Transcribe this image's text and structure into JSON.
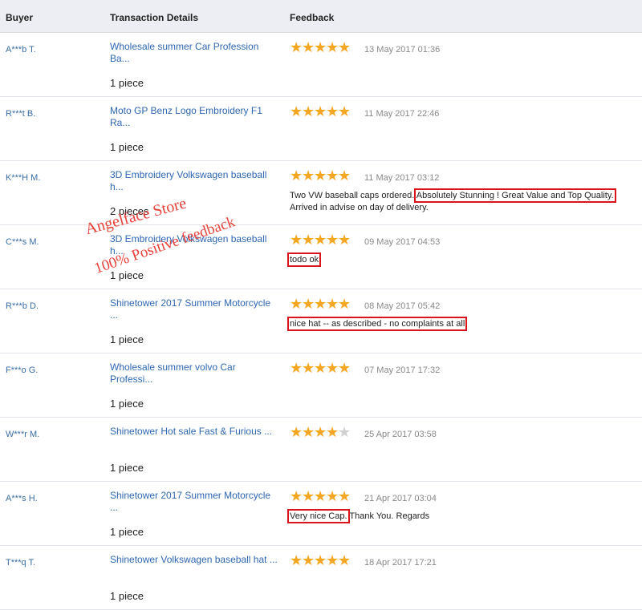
{
  "header": {
    "buyer": "Buyer",
    "transaction": "Transaction Details",
    "feedback": "Feedback"
  },
  "rows": [
    {
      "buyer": "A***b T.",
      "product": "Wholesale summer Car Profession Ba...",
      "qty": "1 piece",
      "stars": 5,
      "date": "13 May 2017 01:36",
      "comment": []
    },
    {
      "buyer": "R***t B.",
      "product": "Moto GP Benz Logo Embroidery F1 Ra...",
      "qty": "1 piece",
      "stars": 5,
      "date": "11 May 2017 22:46",
      "comment": []
    },
    {
      "buyer": "K***H M.",
      "product": "3D Embroidery Volkswagen baseball h...",
      "qty": "2 pieces",
      "stars": 5,
      "date": "11 May 2017 03:12",
      "comment": [
        {
          "text": "Two VW baseball caps ordered. ",
          "hl": false
        },
        {
          "text": "Absolutely Stunning ! Great Value and Top Quality.",
          "hl": true
        },
        {
          "text": " Arrived in advise on day of delivery.",
          "hl": false
        }
      ]
    },
    {
      "buyer": "C***s M.",
      "product": "3D Embroidery Volkswagen baseball h...",
      "qty": "1 piece",
      "stars": 5,
      "date": "09 May 2017 04:53",
      "comment": [
        {
          "text": "todo ok",
          "hl": true
        }
      ]
    },
    {
      "buyer": "R***b D.",
      "product": "Shinetower 2017 Summer Motorcycle ...",
      "qty": "1 piece",
      "stars": 5,
      "date": "08 May 2017 05:42",
      "comment": [
        {
          "text": "nice hat -- as described - no complaints at all",
          "hl": true
        }
      ]
    },
    {
      "buyer": "F***o G.",
      "product": "Wholesale summer volvo Car Professi...",
      "qty": "1 piece",
      "stars": 5,
      "date": "07 May 2017 17:32",
      "comment": []
    },
    {
      "buyer": "W***r M.",
      "product": "Shinetower Hot sale Fast & Furious ...",
      "qty": "1 piece",
      "stars": 4,
      "date": "25 Apr 2017 03:58",
      "comment": []
    },
    {
      "buyer": "A***s H.",
      "product": "Shinetower 2017 Summer Motorcycle ...",
      "qty": "1 piece",
      "stars": 5,
      "date": "21 Apr 2017 03:04",
      "comment": [
        {
          "text": "Very nice Cap.",
          "hl": true
        },
        {
          "text": " Thank You. Regards",
          "hl": false
        }
      ]
    },
    {
      "buyer": "T***q T.",
      "product": "Shinetower Volkswagen baseball hat ...",
      "qty": "1 piece",
      "stars": 5,
      "date": "18 Apr 2017 17:21",
      "comment": []
    }
  ],
  "watermark": {
    "line1": "Angelface Store",
    "line2": "100% Positive feedback"
  },
  "colors": {
    "link": "#2e67b1",
    "star": "#f5a623",
    "highlight": "#d9141b",
    "watermark": "#e8423a"
  }
}
